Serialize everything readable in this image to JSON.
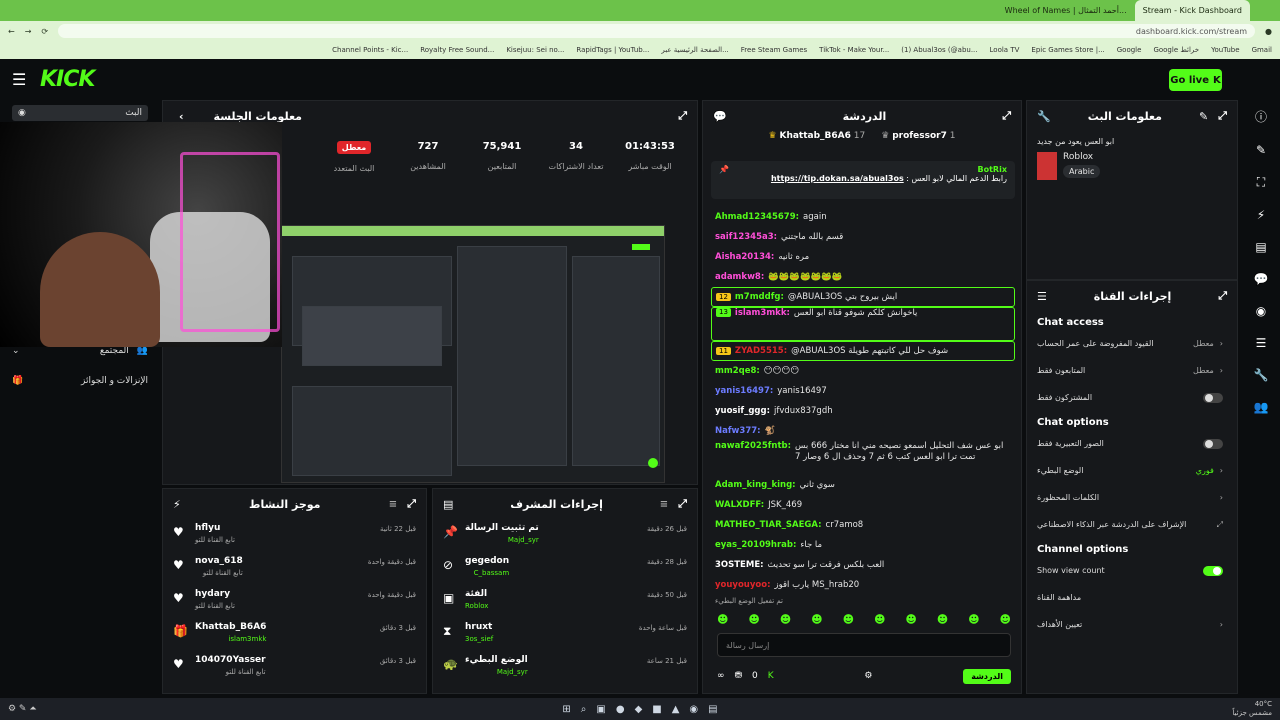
{
  "browser": {
    "tabs": [
      "Wheel of Names | أحمد التمثال...",
      "Stream - Kick Dashboard"
    ],
    "url": "dashboard.kick.com/stream",
    "bookmarks": [
      "Channel Points - Kic...",
      "Royalty Free Sound...",
      "Kisejuu: Sei no...",
      "RapidTags | YouTub...",
      "الصفحة الرئيسية عبر...",
      "Free Steam Games",
      "TikTok - Make Your...",
      "(1) Abual3os (@abu...",
      "Loola TV",
      "Epic Games Store |...",
      "Google",
      "Google خرائط",
      "YouTube",
      "Gmail"
    ]
  },
  "topbar": {
    "logo": "KICK",
    "golive": "Go live"
  },
  "sidebar": {
    "items": [
      {
        "label": "البث"
      },
      {
        "label": "المجتمع"
      },
      {
        "label": "الإنزالات و الجوائز"
      }
    ]
  },
  "session": {
    "title": "معلومات الجلسة",
    "badge": "معطل",
    "stats": [
      {
        "label": "الوقت مباشر",
        "value": "01:43:53"
      },
      {
        "label": "تعداد الاشتراكات",
        "value": "34"
      },
      {
        "label": "المتابعين",
        "value": "75,941"
      },
      {
        "label": "المشاهدين",
        "value": "727"
      },
      {
        "label": "البث المتعدد",
        "value": ""
      }
    ]
  },
  "activity": {
    "title": "موجز النشاط",
    "items": [
      {
        "name": "hflyu",
        "sub": "تابع القناة للتو",
        "time": "قبل 22 ثانية"
      },
      {
        "name": "nova_618",
        "sub": "تابع القناة للتو",
        "time": "قبل دقيقة واحدة"
      },
      {
        "name": "hydary",
        "sub": "تابع القناة للتو",
        "time": "قبل دقيقة واحدة"
      },
      {
        "name": "Khattab_B6A6",
        "sub": "islam3mkk",
        "time": "قبل 3 دقائق"
      },
      {
        "name": "104070Yasser",
        "sub": "تابع القناة للتو",
        "time": "قبل 3 دقائق"
      }
    ]
  },
  "modact": {
    "title": "إجراءات المشرف",
    "items": [
      {
        "name": "تم تثبيت الرسالة",
        "who": "Majd_syr",
        "time": "قبل 26 دقيقة"
      },
      {
        "name": "gegedon",
        "who": "C_bassam",
        "time": "قبل 28 دقيقة"
      },
      {
        "name": "الفئة",
        "who": "Roblox",
        "time": "قبل 50 دقيقة"
      },
      {
        "name": "hruxt",
        "who": "3os_sief",
        "time": "قبل ساعة واحدة"
      },
      {
        "name": "الوضع البطيء",
        "who": "Majd_syr",
        "time": "قبل 21 ساعة"
      }
    ]
  },
  "chat": {
    "title": "الدردشة",
    "pinned_users": [
      "Khattab_B6A6",
      "17",
      "professor7",
      "1"
    ],
    "pinned_by": "BotRix",
    "pinned_text": "رابط الدعم المالي لابو العس",
    "pinned_link": "https://tip.dokan.sa/abual3os",
    "messages": [
      {
        "user": "Ahmad12345679:",
        "text": "again",
        "color": "#53fc18"
      },
      {
        "user": "saif12345a3:",
        "text": "قسم بالله ماجتني",
        "color": "#ff4fd8"
      },
      {
        "user": "Aisha20134:",
        "text": "مره ثانيه",
        "color": "#ff4fd8"
      },
      {
        "user": "adamkw8:",
        "text": "🐸🐸🐸🐸🐸🐸🐸",
        "color": "#ff4fd8"
      },
      {
        "user": "m7mddfg:",
        "text": "@ABUAL3OS ايش بيروح بتي",
        "color": "#53fc18",
        "badge": "12"
      },
      {
        "user": "islam3mkk:",
        "text": "ياخوانش كلكم شوفو قناة ابو العس",
        "color": "#ff4fd8",
        "badge": "13"
      },
      {
        "user": "ZYAD5515:",
        "text": "@ABUAL3OS شوف حل للي كاتبتهم طويلة",
        "color": "#e0262a",
        "badge": "11"
      },
      {
        "user": "mm2qe8:",
        "text": "😶😶😶😶",
        "color": "#53fc18"
      },
      {
        "user": "yanis16497:",
        "text": "yanis16497",
        "color": "#6c7cff"
      },
      {
        "user": "yuosif_ggg:",
        "text": "jfvdux837gdh",
        "color": "#fff"
      },
      {
        "user": "Nafw377:",
        "text": "🐒",
        "color": "#6c7cff"
      },
      {
        "user": "nawaf2025fntb:",
        "text": "ابو عس شف التحليل اسمعو نصيحه مني انا مختار 666 بس تمت ترا ابو العس كتب 6 ثم 7 وحذف ال 6 وصار 7",
        "color": "#53fc18"
      },
      {
        "user": "Adam_king_king:",
        "text": "سوي ثاني",
        "color": "#53fc18"
      },
      {
        "user": "WALXDFF:",
        "text": "JSK_469",
        "color": "#53fc18"
      },
      {
        "user": "MATHEO_TIAR_SAEGA:",
        "text": "cr7amo8",
        "color": "#53fc18"
      },
      {
        "user": "eyas_20109hrab:",
        "text": "ما جاء",
        "color": "#53fc18"
      },
      {
        "user": "3OSTEME:",
        "text": "العب بلكس فرقت ترا سو تحديث",
        "color": "#fff"
      },
      {
        "user": "youyouyoo:",
        "text": "يارب اقوز MS_hrab20",
        "color": "#e0262a"
      }
    ],
    "slowmode": "تم تفعيل الوضع البطيء",
    "input_placeholder": "إرسال رسالة",
    "count": "0",
    "send": "الدردشة"
  },
  "streaminfo": {
    "title": "معلومات البث",
    "stream_title": "ابو العس يعود من جديد",
    "category": "Roblox",
    "language": "Arabic"
  },
  "channelact": {
    "title": "إجراءات القناة",
    "chat_access": "Chat access",
    "access_rows": [
      {
        "label": "القيود المفروضة على عمر الحساب",
        "value": "معطل"
      },
      {
        "label": "المتابعون فقط",
        "value": "معطل"
      },
      {
        "label": "المشتركون فقط",
        "value": ""
      }
    ],
    "chat_options": "Chat options",
    "options_rows": [
      {
        "label": "الصور التعبيرية فقط",
        "value": ""
      },
      {
        "label": "الوضع البطيء",
        "value": "فوري"
      },
      {
        "label": "الكلمات المحظورة",
        "value": ""
      },
      {
        "label": "الإشراف على الدردشة عبر الذكاء الاصطناعي",
        "value": ""
      }
    ],
    "channel_options": "Channel options",
    "show_view_count": "Show view count",
    "channel_rows": [
      {
        "label": "مداهمة القناة"
      },
      {
        "label": "تعيين الأهداف"
      }
    ]
  },
  "taskbar": {
    "weather": "",
    "clock_temp": "40°C",
    "clock_sub": "مشمس جزئياً"
  },
  "colors": {
    "accent": "#53fc18",
    "panel": "#16181b",
    "bg": "#0b0d0f",
    "live": "#e0262a"
  }
}
